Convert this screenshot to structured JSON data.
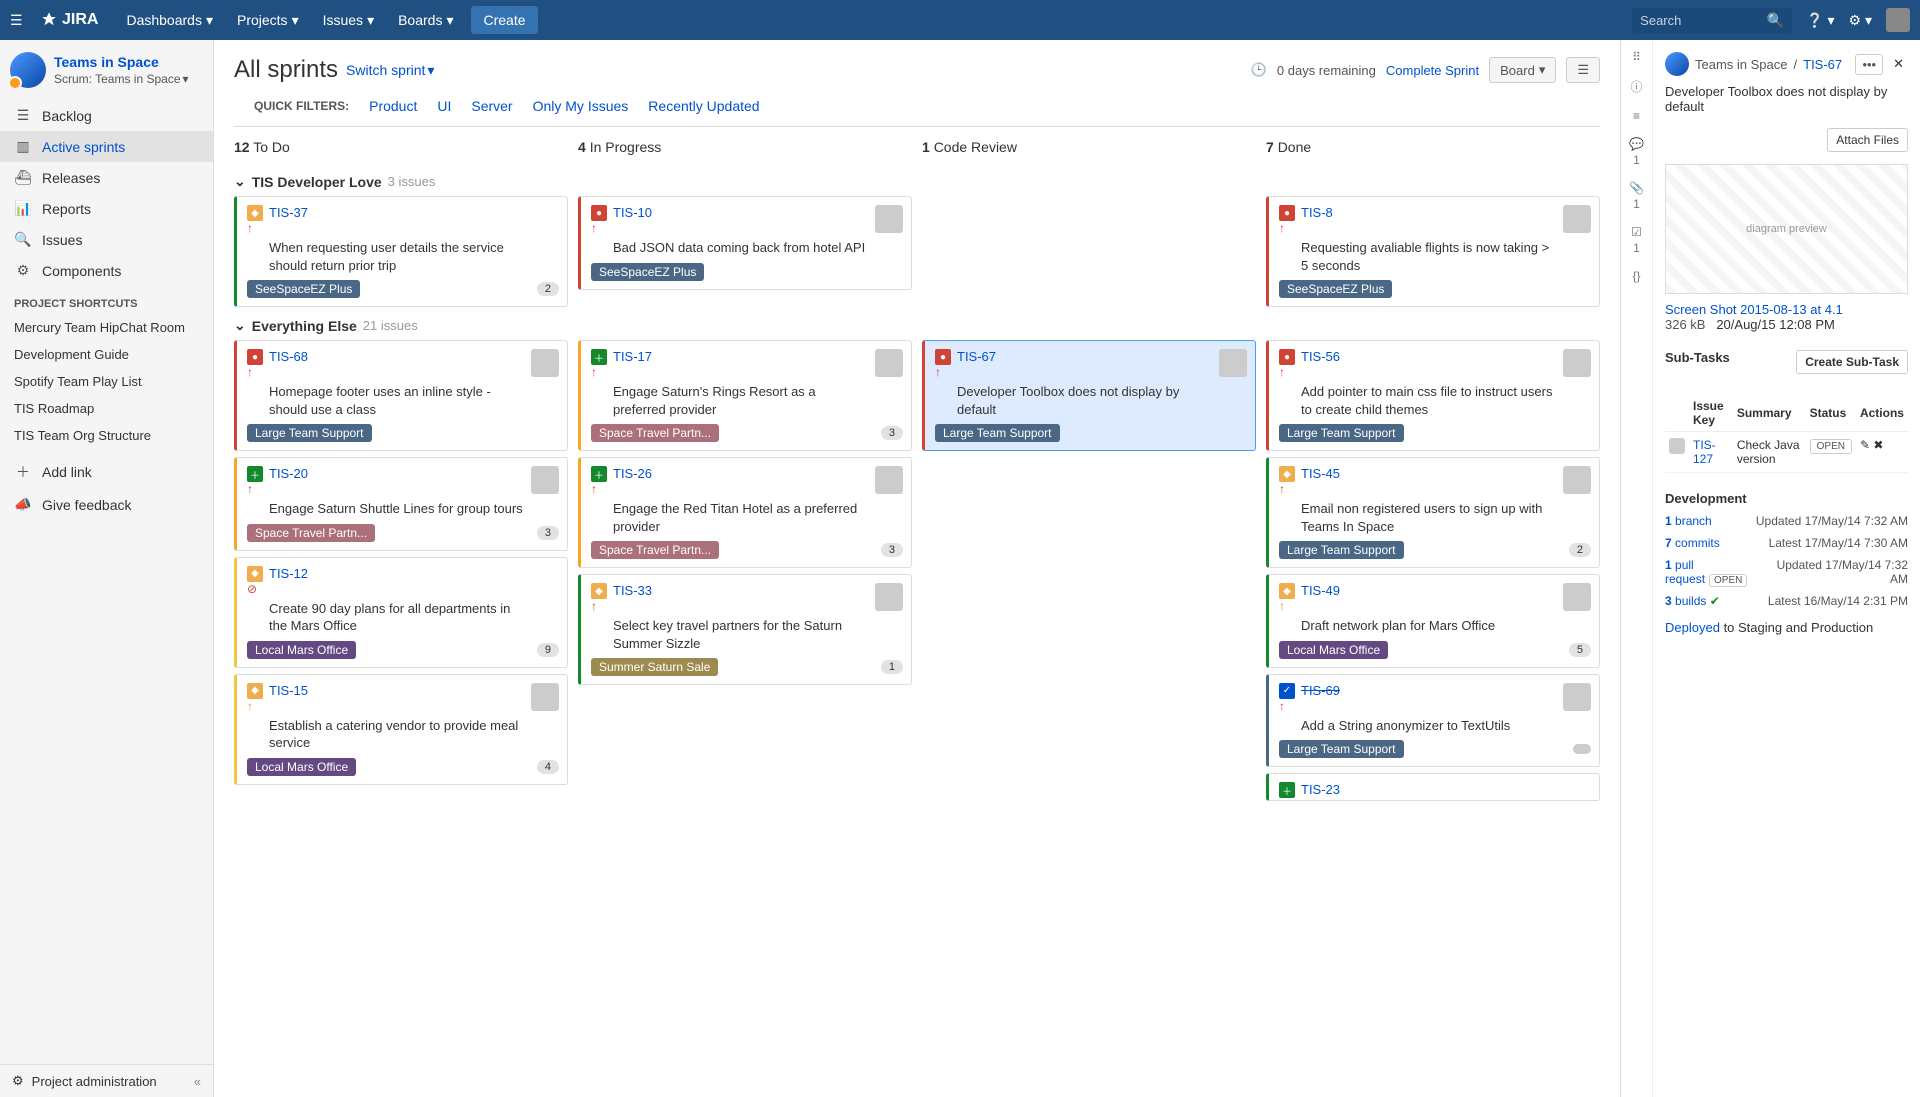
{
  "nav": {
    "logo": "JIRA",
    "menus": [
      "Dashboards",
      "Projects",
      "Issues",
      "Boards"
    ],
    "create": "Create",
    "search_placeholder": "Search"
  },
  "project": {
    "name": "Teams in Space",
    "type": "Scrum: Teams in Space"
  },
  "sidebar": {
    "items": [
      {
        "icon": "backlog",
        "label": "Backlog"
      },
      {
        "icon": "sprints",
        "label": "Active sprints"
      },
      {
        "icon": "releases",
        "label": "Releases"
      },
      {
        "icon": "reports",
        "label": "Reports"
      },
      {
        "icon": "issues",
        "label": "Issues"
      },
      {
        "icon": "components",
        "label": "Components"
      }
    ],
    "shortcuts_label": "PROJECT SHORTCUTS",
    "shortcuts": [
      "Mercury Team HipChat Room",
      "Development Guide",
      "Spotify Team Play List",
      "TIS Roadmap",
      "TIS Team Org Structure"
    ],
    "add_link": "Add link",
    "feedback": "Give feedback",
    "admin": "Project administration"
  },
  "board": {
    "title": "All sprints",
    "switch": "Switch sprint",
    "remaining": "0 days remaining",
    "complete": "Complete Sprint",
    "board_btn": "Board",
    "qf_label": "QUICK FILTERS:",
    "quick_filters": [
      "Product",
      "UI",
      "Server",
      "Only My Issues",
      "Recently Updated"
    ],
    "columns": [
      {
        "count": "12",
        "name": "To Do"
      },
      {
        "count": "4",
        "name": "In Progress"
      },
      {
        "count": "1",
        "name": "Code Review"
      },
      {
        "count": "7",
        "name": "Done"
      }
    ],
    "lane1": {
      "title": "TIS Developer Love",
      "sub": "3 issues"
    },
    "lane2": {
      "title": "Everything Else",
      "sub": "21 issues"
    }
  },
  "cards": {
    "tis37": {
      "key": "TIS-37",
      "summary": "When requesting user details the service should return prior trip",
      "epic": "SeeSpaceEZ Plus",
      "badge": "2"
    },
    "tis10": {
      "key": "TIS-10",
      "summary": "Bad JSON data coming back from hotel API",
      "epic": "SeeSpaceEZ Plus"
    },
    "tis8": {
      "key": "TIS-8",
      "summary": "Requesting avaliable flights is now taking > 5 seconds",
      "epic": "SeeSpaceEZ Plus"
    },
    "tis68": {
      "key": "TIS-68",
      "summary": "Homepage footer uses an inline style - should use a class",
      "epic": "Large Team Support"
    },
    "tis20": {
      "key": "TIS-20",
      "summary": "Engage Saturn Shuttle Lines for group tours",
      "epic": "Space Travel Partn...",
      "badge": "3"
    },
    "tis12": {
      "key": "TIS-12",
      "summary": "Create 90 day plans for all departments in the Mars Office",
      "epic": "Local Mars Office",
      "badge": "9"
    },
    "tis15": {
      "key": "TIS-15",
      "summary": "Establish a catering vendor to provide meal service",
      "epic": "Local Mars Office",
      "badge": "4"
    },
    "tis17": {
      "key": "TIS-17",
      "summary": "Engage Saturn's Rings Resort as a preferred provider",
      "epic": "Space Travel Partn...",
      "badge": "3"
    },
    "tis26": {
      "key": "TIS-26",
      "summary": "Engage the Red Titan Hotel as a preferred provider",
      "epic": "Space Travel Partn...",
      "badge": "3"
    },
    "tis33": {
      "key": "TIS-33",
      "summary": "Select key travel partners for the Saturn Summer Sizzle",
      "epic": "Summer Saturn Sale",
      "badge": "1"
    },
    "tis67": {
      "key": "TIS-67",
      "summary": "Developer Toolbox does not display by default",
      "epic": "Large Team Support"
    },
    "tis56": {
      "key": "TIS-56",
      "summary": "Add pointer to main css file to instruct users to create child themes",
      "epic": "Large Team Support"
    },
    "tis45": {
      "key": "TIS-45",
      "summary": "Email non registered users to sign up with Teams In Space",
      "epic": "Large Team Support",
      "badge": "2"
    },
    "tis49": {
      "key": "TIS-49",
      "summary": "Draft network plan for Mars Office",
      "epic": "Local Mars Office",
      "badge": "5"
    },
    "tis69": {
      "key": "TIS-69",
      "summary": "Add a String anonymizer to TextUtils",
      "epic": "Large Team Support"
    },
    "tis23": {
      "key": "TIS-23"
    }
  },
  "detail": {
    "project": "Teams in Space",
    "key": "TIS-67",
    "title": "Developer Toolbox does not display by default",
    "attach_btn": "Attach Files",
    "attachment": {
      "name": "Screen Shot 2015-08-13 at 4.1",
      "size": "326 kB",
      "date": "20/Aug/15 12:08 PM"
    },
    "subtasks_label": "Sub-Tasks",
    "create_sub": "Create Sub-Task",
    "sub_headers": {
      "key": "Issue Key",
      "summary": "Summary",
      "status": "Status",
      "actions": "Actions"
    },
    "subtask": {
      "key": "TIS-127",
      "summary": "Check Java version",
      "status": "OPEN"
    },
    "dev_label": "Development",
    "dev": {
      "branch": {
        "count": "1",
        "label": "branch"
      },
      "commits": {
        "count": "7",
        "label": "commits"
      },
      "pr": {
        "count": "1",
        "label": "pull request",
        "status": "OPEN"
      },
      "builds": {
        "count": "3",
        "label": "builds"
      }
    },
    "times": {
      "branch": "Updated 17/May/14 7:32 AM",
      "commits": "Latest 17/May/14 7:30 AM",
      "pr": "Updated 17/May/14 7:32 AM",
      "builds": "Latest 16/May/14 2:31 PM"
    },
    "deployed": {
      "prefix": "Deployed",
      "rest": "to Staging and Production"
    },
    "rail": {
      "comments": "1",
      "attach": "1",
      "sub": "1"
    }
  }
}
